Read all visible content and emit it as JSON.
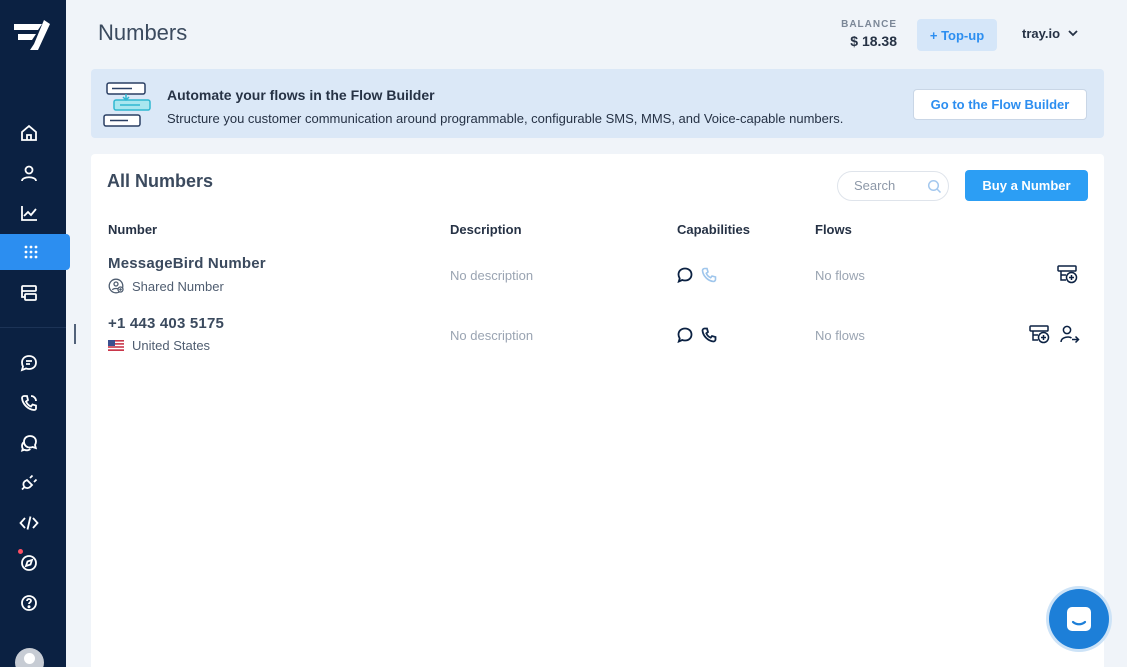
{
  "header": {
    "title": "Numbers",
    "balance_label": "BALANCE",
    "balance_value": "$ 18.38",
    "topup_label": "+ Top-up",
    "account_name": "tray.io"
  },
  "sidebar": {
    "items": [
      {
        "name": "home",
        "icon": "home-icon"
      },
      {
        "name": "contacts",
        "icon": "user-icon"
      },
      {
        "name": "analytics",
        "icon": "chart-icon"
      },
      {
        "name": "numbers",
        "icon": "dialpad-icon",
        "active": true
      },
      {
        "name": "flows",
        "icon": "flow-icon"
      },
      {
        "name": "sms",
        "icon": "message-icon"
      },
      {
        "name": "voice",
        "icon": "phone-icon"
      },
      {
        "name": "conversations",
        "icon": "conversations-icon"
      },
      {
        "name": "integrations",
        "icon": "plug-icon"
      },
      {
        "name": "developers",
        "icon": "code-icon"
      },
      {
        "name": "explore",
        "icon": "compass-icon"
      },
      {
        "name": "help",
        "icon": "help-icon"
      }
    ]
  },
  "banner": {
    "title": "Automate your flows in the Flow Builder",
    "text": "Structure you customer communication around programmable, configurable SMS, MMS, and Voice-capable numbers.",
    "button_label": "Go to the Flow Builder"
  },
  "card": {
    "title": "All Numbers",
    "search_placeholder": "Search",
    "buy_label": "Buy a Number"
  },
  "table": {
    "columns": [
      "Number",
      "Description",
      "Capabilities",
      "Flows"
    ],
    "rows": [
      {
        "number": "MessageBird Number",
        "sub": "Shared Number",
        "description": "No description",
        "capabilities": {
          "sms": true,
          "voice": false
        },
        "flows": "No flows"
      },
      {
        "number": "+1 443 403 5175",
        "sub": "United States",
        "description": "No description",
        "capabilities": {
          "sms": true,
          "voice": true
        },
        "flows": "No flows"
      }
    ]
  },
  "colors": {
    "sidebar_bg": "#0b2142",
    "accent": "#2c8ef0",
    "banner_bg": "#dbe8f7",
    "page_bg": "#f0f4f9"
  }
}
